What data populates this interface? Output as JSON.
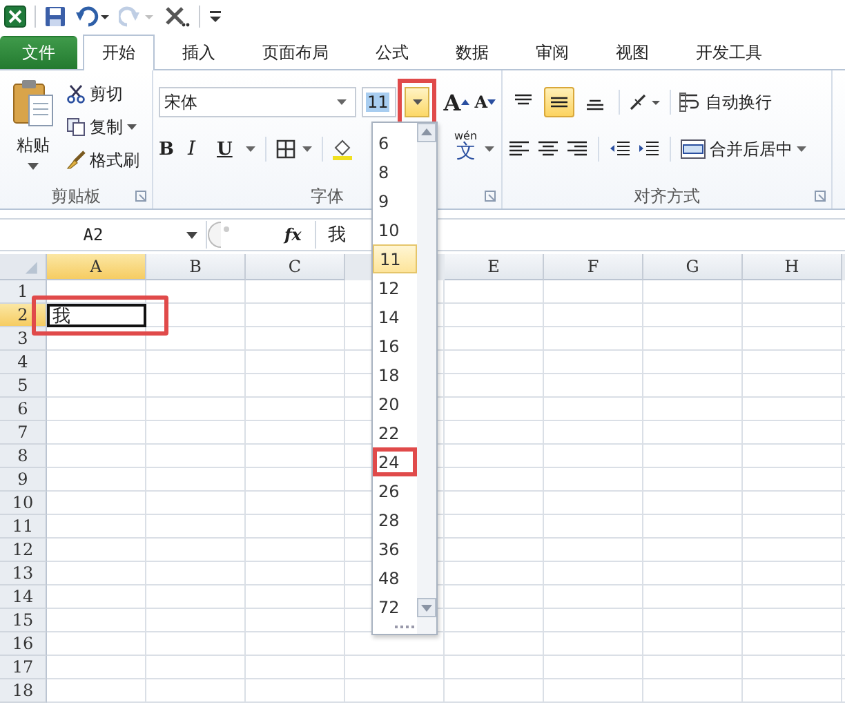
{
  "quick_access": [
    {
      "kind": "excel",
      "disabled": false
    },
    {
      "kind": "save",
      "disabled": false
    },
    {
      "kind": "undo",
      "disabled": false
    },
    {
      "kind": "redo",
      "disabled": true
    },
    {
      "kind": "tools",
      "disabled": false
    },
    {
      "kind": "customize",
      "disabled": false
    }
  ],
  "tabs": [
    {
      "label": "文件",
      "kind": "file",
      "selected": false
    },
    {
      "label": "开始",
      "kind": "tab",
      "selected": true
    },
    {
      "label": "插入",
      "kind": "tab",
      "selected": false
    },
    {
      "label": "页面布局",
      "kind": "tab",
      "selected": false
    },
    {
      "label": "公式",
      "kind": "tab",
      "selected": false
    },
    {
      "label": "数据",
      "kind": "tab",
      "selected": false
    },
    {
      "label": "审阅",
      "kind": "tab",
      "selected": false
    },
    {
      "label": "视图",
      "kind": "tab",
      "selected": false
    },
    {
      "label": "开发工具",
      "kind": "tab",
      "selected": false
    }
  ],
  "clipboard": {
    "label": "剪贴板",
    "paste": "粘贴",
    "cut": "剪切",
    "copy": "复制",
    "format_painter": "格式刷"
  },
  "font": {
    "label": "字体",
    "font_name": "宋体",
    "font_size": "11",
    "size_arrow_annotated": true,
    "grow": "A",
    "shrink": "A",
    "bold": "B",
    "italic": "I",
    "underline": "U",
    "phonetic_pinyin": "wén",
    "phonetic_glyph": "文"
  },
  "alignment": {
    "label": "对齐方式",
    "wrap_text": "自动换行",
    "merge_center": "合并后居中",
    "vertical": [
      {
        "selected": false
      },
      {
        "selected": true
      },
      {
        "selected": false
      }
    ]
  },
  "formula_bar": {
    "name_box": "A2",
    "fx": "fx",
    "content": "我"
  },
  "sheet": {
    "columns": [
      {
        "kind": "column",
        "label": "A",
        "selected": true
      },
      {
        "kind": "column",
        "label": "B",
        "selected": false
      },
      {
        "kind": "column",
        "label": "C",
        "selected": false
      },
      {
        "kind": "covered"
      },
      {
        "kind": "column",
        "label": "E",
        "selected": false
      },
      {
        "kind": "column",
        "label": "F",
        "selected": false
      },
      {
        "kind": "column",
        "label": "G",
        "selected": false
      },
      {
        "kind": "column",
        "label": "H",
        "selected": false
      }
    ],
    "rows": [
      {
        "label": "1",
        "selected": false,
        "cells": []
      },
      {
        "label": "2",
        "selected": true,
        "cells": [
          {
            "value": "我",
            "active": true,
            "annotated": true
          }
        ]
      },
      {
        "label": "3",
        "selected": false,
        "cells": []
      },
      {
        "label": "4",
        "selected": false,
        "cells": []
      },
      {
        "label": "5",
        "selected": false,
        "cells": []
      },
      {
        "label": "6",
        "selected": false,
        "cells": []
      },
      {
        "label": "7",
        "selected": false,
        "cells": []
      },
      {
        "label": "8",
        "selected": false,
        "cells": []
      },
      {
        "label": "9",
        "selected": false,
        "cells": []
      },
      {
        "label": "10",
        "selected": false,
        "cells": []
      },
      {
        "label": "11",
        "selected": false,
        "cells": []
      },
      {
        "label": "12",
        "selected": false,
        "cells": []
      },
      {
        "label": "13",
        "selected": false,
        "cells": []
      },
      {
        "label": "14",
        "selected": false,
        "cells": []
      },
      {
        "label": "15",
        "selected": false,
        "cells": []
      },
      {
        "label": "16",
        "selected": false,
        "cells": []
      },
      {
        "label": "17",
        "selected": false,
        "cells": []
      },
      {
        "label": "18",
        "selected": false,
        "cells": []
      }
    ]
  },
  "size_dropdown": {
    "items": [
      {
        "label": "6",
        "selected": false,
        "annotated": false
      },
      {
        "label": "8",
        "selected": false,
        "annotated": false
      },
      {
        "label": "9",
        "selected": false,
        "annotated": false
      },
      {
        "label": "10",
        "selected": false,
        "annotated": false
      },
      {
        "label": "11",
        "selected": true,
        "annotated": false
      },
      {
        "label": "12",
        "selected": false,
        "annotated": false
      },
      {
        "label": "14",
        "selected": false,
        "annotated": false
      },
      {
        "label": "16",
        "selected": false,
        "annotated": false
      },
      {
        "label": "18",
        "selected": false,
        "annotated": false
      },
      {
        "label": "20",
        "selected": false,
        "annotated": false
      },
      {
        "label": "22",
        "selected": false,
        "annotated": false
      },
      {
        "label": "24",
        "selected": false,
        "annotated": true
      },
      {
        "label": "26",
        "selected": false,
        "annotated": false
      },
      {
        "label": "28",
        "selected": false,
        "annotated": false
      },
      {
        "label": "36",
        "selected": false,
        "annotated": false
      },
      {
        "label": "48",
        "selected": false,
        "annotated": false
      },
      {
        "label": "72",
        "selected": false,
        "annotated": false
      }
    ]
  }
}
